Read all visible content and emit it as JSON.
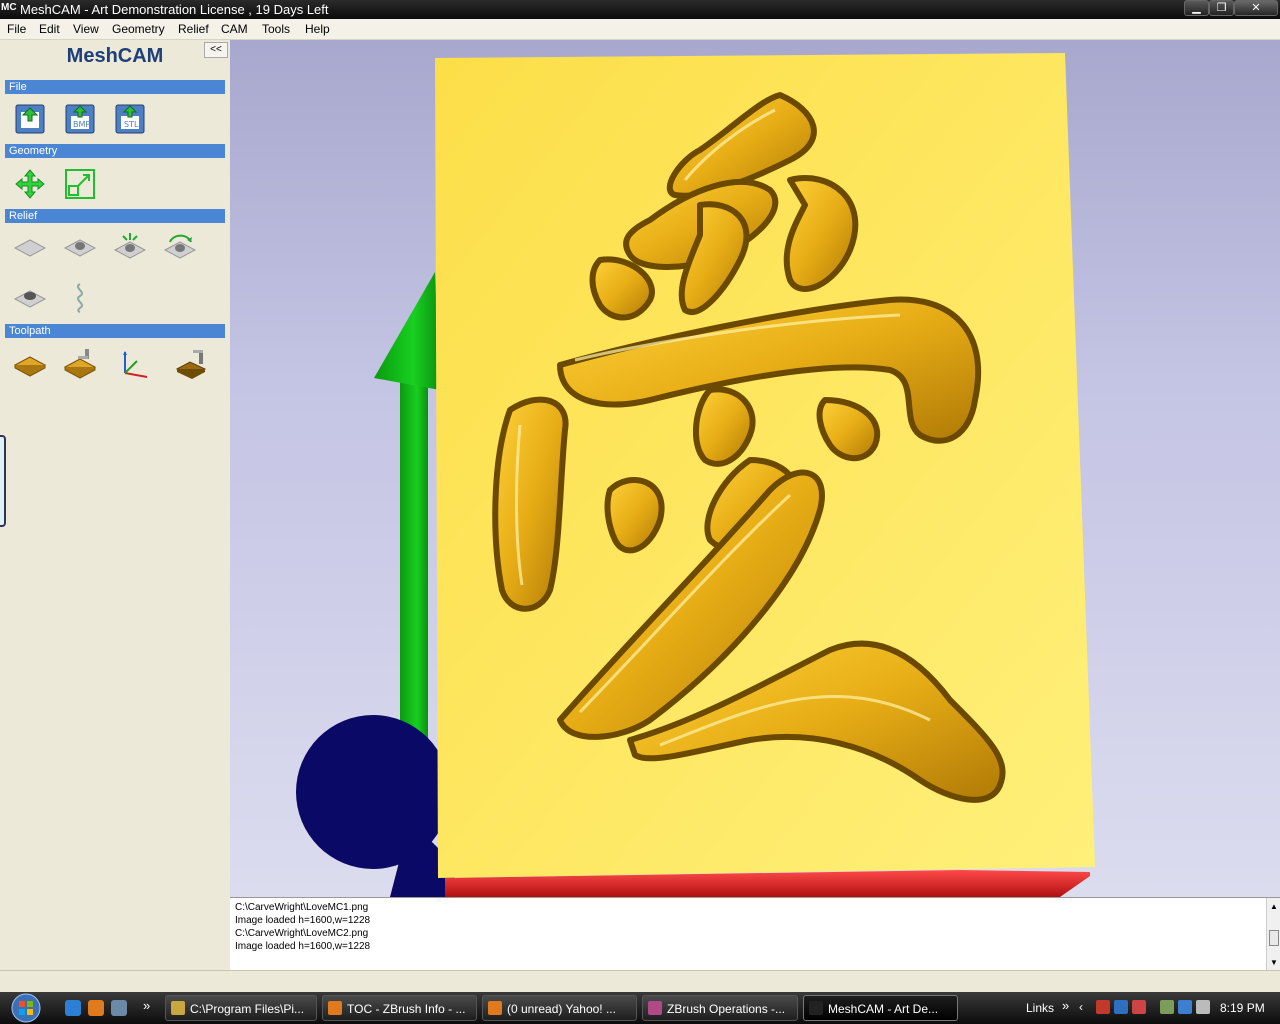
{
  "window": {
    "app_icon": "MC",
    "title": "MeshCAM - Art Demonstration License  , 19 Days Left",
    "controls": [
      "minimize-icon",
      "maximize-icon",
      "close-icon"
    ]
  },
  "menu": [
    "File",
    "Edit",
    "View",
    "Geometry",
    "Relief",
    "CAM",
    "Tools",
    "Help"
  ],
  "sidebar": {
    "brand": "MeshCAM",
    "collapse_label": "<<",
    "sections": [
      {
        "title": "File",
        "tools": [
          "open-file-icon",
          "open-bmp-icon",
          "open-stl-icon"
        ]
      },
      {
        "title": "Geometry",
        "tools": [
          "move-icon",
          "scale-icon"
        ]
      },
      {
        "title": "Relief",
        "tools": [
          "flat-relief-icon",
          "raised-relief-icon",
          "extrude-relief-icon",
          "rotate-relief-icon",
          "smooth-relief-icon",
          "wave-relief-icon"
        ]
      },
      {
        "title": "Toolpath",
        "tools": [
          "stock-icon",
          "define-tool-icon",
          "axes-origin-icon",
          "cutter-toolpath-icon"
        ]
      }
    ]
  },
  "log": {
    "lines": [
      "C:\\CarveWright\\LoveMC1.png",
      "Image loaded h=1600,w=1228",
      "C:\\CarveWright\\LoveMC2.png",
      "Image loaded h=1600,w=1228"
    ]
  },
  "taskbar": {
    "start_icon": "windows-start-icon",
    "overflow_label": "»",
    "tasks": [
      {
        "label": "C:\\Program Files\\Pi...",
        "icon": "folder-icon",
        "color": "#c9a640",
        "active": false
      },
      {
        "label": "TOC - ZBrush Info - ...",
        "icon": "firefox-icon",
        "color": "#e07a1f",
        "active": false
      },
      {
        "label": "(0 unread) Yahoo! ...",
        "icon": "firefox-icon",
        "color": "#e07a1f",
        "active": false
      },
      {
        "label": "ZBrush Operations -...",
        "icon": "zbrush-icon",
        "color": "#b04a86",
        "active": false
      },
      {
        "label": "MeshCAM - Art De...",
        "icon": "meshcam-icon",
        "color": "#222222",
        "active": true
      }
    ],
    "links_label": "Links",
    "links_overflow": "»",
    "clock": "8:19 PM"
  },
  "colors": {
    "section_header": "#4b86d4",
    "brand_text": "#1d3f7a",
    "plate": "#fbe45a",
    "relief_gold": "#e9b21c",
    "axis_x": "#e42727",
    "axis_y": "#0fb312",
    "axis_z": "#0a0a66"
  }
}
